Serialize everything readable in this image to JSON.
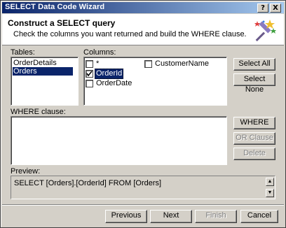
{
  "window": {
    "title": "SELECT Data Code Wizard",
    "help_label": "?",
    "close_label": "X"
  },
  "header": {
    "heading": "Construct a SELECT query",
    "subheading": "Check the columns you want returned and build the WHERE clause."
  },
  "tables": {
    "label": "Tables:",
    "items": [
      {
        "label": "OrderDetails",
        "selected": false
      },
      {
        "label": "Orders",
        "selected": true
      }
    ]
  },
  "columns": {
    "label": "Columns:",
    "items": [
      {
        "label": "*",
        "checked": false
      },
      {
        "label": "OrderId",
        "checked": true
      },
      {
        "label": "OrderDate",
        "checked": false
      },
      {
        "label": "CustomerName",
        "checked": false
      }
    ]
  },
  "column_buttons": {
    "select_all": "Select All",
    "select_none": "Select None"
  },
  "where": {
    "label": "WHERE clause:",
    "where_button": "WHERE",
    "or_clause_button": "OR Clause",
    "delete_button": "Delete"
  },
  "preview": {
    "label": "Preview:",
    "text": "SELECT [Orders].[OrderId] FROM [Orders]"
  },
  "footer": {
    "previous": "Previous",
    "next": "Next",
    "finish": "Finish",
    "cancel": "Cancel"
  }
}
